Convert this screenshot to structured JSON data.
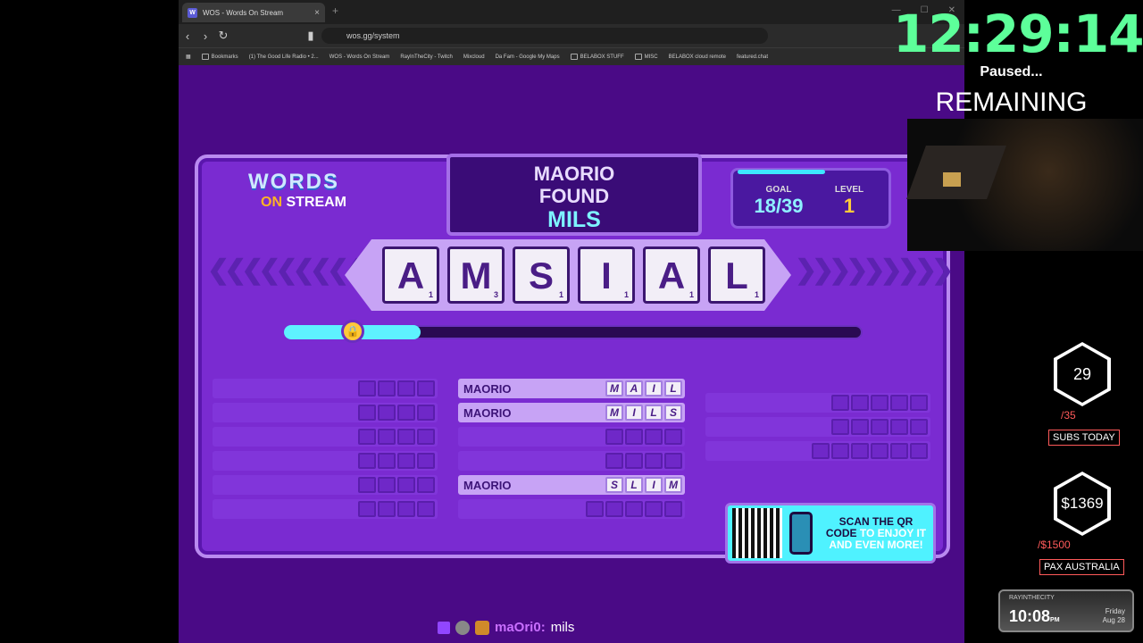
{
  "browser": {
    "tab_title": "WOS - Words On Stream",
    "url": "wos.gg/system",
    "bookmarks": [
      "Bookmarks",
      "(1) The Good Life Radio • 2...",
      "WOS - Words On Stream",
      "RayInTheCity - Twitch",
      "Mixcloud",
      "Da Fam - Google My Maps",
      "BELABOX STUFF",
      "MISC",
      "BELABOX cloud remote",
      "featured.chat"
    ]
  },
  "game": {
    "logo_line1": "WORDS",
    "logo_on": "ON",
    "logo_stream": "STREAM",
    "found_who": "MAORIO",
    "found_verb": "FOUND",
    "found_word": "MILS",
    "goal_label": "GOAL",
    "goal_value": "18/39",
    "level_label": "LEVEL",
    "level_value": "1",
    "tiles": [
      {
        "letter": "A",
        "score": "1"
      },
      {
        "letter": "M",
        "score": "3"
      },
      {
        "letter": "S",
        "score": "1"
      },
      {
        "letter": "I",
        "score": "1"
      },
      {
        "letter": "A",
        "score": "1"
      },
      {
        "letter": "L",
        "score": "1"
      }
    ],
    "progress": 0.19,
    "qr_text_1": "SCAN THE QR",
    "qr_text_2": "CODE",
    "qr_text_3": "TO ENJOY IT",
    "qr_text_4": "AND EVEN MORE!",
    "words_mid": [
      {
        "name": "MAORIO",
        "letters": [
          "M",
          "A",
          "I",
          "L"
        ]
      },
      {
        "name": "MAORIO",
        "letters": [
          "M",
          "I",
          "L",
          "S"
        ]
      },
      {
        "name": "",
        "letters": [
          "",
          "",
          "",
          ""
        ]
      },
      {
        "name": "",
        "letters": [
          "",
          "",
          "",
          ""
        ]
      },
      {
        "name": "MAORIO",
        "letters": [
          "S",
          "L",
          "I",
          "M"
        ]
      },
      {
        "name": "",
        "letters": [
          "",
          "",
          "",
          "",
          ""
        ]
      }
    ]
  },
  "chat": {
    "user": "maOri0:",
    "message": "mils"
  },
  "overlay": {
    "timer": "12:29:14",
    "paused": "Paused...",
    "remaining": "REMAINING",
    "subs_count": "29",
    "subs_goal": "/35",
    "subs_label": "SUBS TODAY",
    "money_count": "$1369",
    "money_goal": "/$1500",
    "money_label": "PAX AUSTRALIA",
    "clock_channel": "RAYINTHECITY",
    "clock_time": "10:08",
    "clock_ampm": "PM",
    "clock_day": "Friday",
    "clock_date": "Aug 28"
  }
}
